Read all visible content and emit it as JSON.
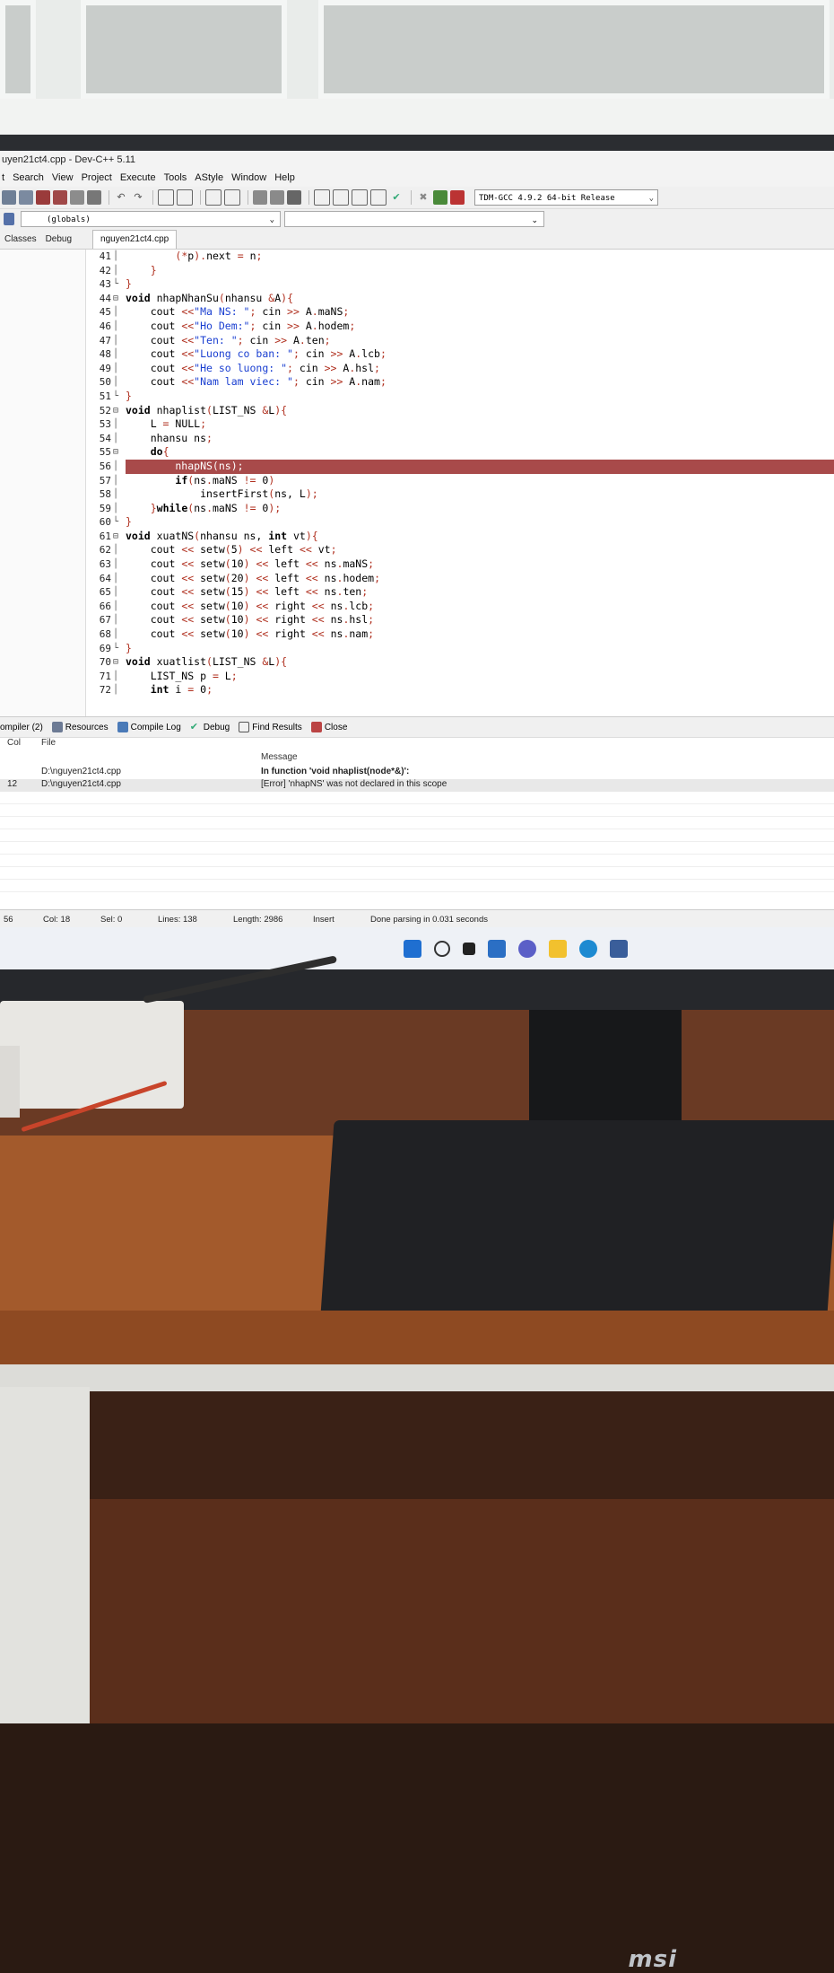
{
  "window": {
    "title": "uyen21ct4.cpp - Dev-C++ 5.11"
  },
  "menu": [
    "t",
    "Search",
    "View",
    "Project",
    "Execute",
    "Tools",
    "AStyle",
    "Window",
    "Help"
  ],
  "toolbar": {
    "compiler": "TDM-GCC 4.9.2 64-bit Release"
  },
  "scope": {
    "value": "(globals)"
  },
  "side_tabs": [
    "Classes",
    "Debug"
  ],
  "file_tab": "nguyen21ct4.cpp",
  "editor": {
    "lines": [
      {
        "n": "41",
        "code": "        (*p).next = n;"
      },
      {
        "n": "42",
        "code": "    }"
      },
      {
        "n": "43",
        "code": "}"
      },
      {
        "n": "44",
        "code": "void nhapNhanSu(nhansu &A){"
      },
      {
        "n": "45",
        "code": "    cout <<\"Ma NS: \"; cin >> A.maNS;"
      },
      {
        "n": "46",
        "code": "    cout <<\"Ho Dem:\"; cin >> A.hodem;"
      },
      {
        "n": "47",
        "code": "    cout <<\"Ten: \"; cin >> A.ten;"
      },
      {
        "n": "48",
        "code": "    cout <<\"Luong co ban: \"; cin >> A.lcb;"
      },
      {
        "n": "49",
        "code": "    cout <<\"He so luong: \"; cin >> A.hsl;"
      },
      {
        "n": "50",
        "code": "    cout <<\"Nam lam viec: \"; cin >> A.nam;"
      },
      {
        "n": "51",
        "code": "}"
      },
      {
        "n": "52",
        "code": "void nhaplist(LIST_NS &L){"
      },
      {
        "n": "53",
        "code": "    L = NULL;"
      },
      {
        "n": "54",
        "code": "    nhansu ns;"
      },
      {
        "n": "55",
        "code": "    do{"
      },
      {
        "n": "56",
        "code": "        nhapNS(ns);"
      },
      {
        "n": "57",
        "code": "        if(ns.maNS != 0)"
      },
      {
        "n": "58",
        "code": "            insertFirst(ns, L);"
      },
      {
        "n": "59",
        "code": "    }while(ns.maNS != 0);"
      },
      {
        "n": "60",
        "code": "}"
      },
      {
        "n": "61",
        "code": "void xuatNS(nhansu ns, int vt){"
      },
      {
        "n": "62",
        "code": "    cout << setw(5) << left << vt;"
      },
      {
        "n": "63",
        "code": "    cout << setw(10) << left << ns.maNS;"
      },
      {
        "n": "64",
        "code": "    cout << setw(20) << left << ns.hodem;"
      },
      {
        "n": "65",
        "code": "    cout << setw(15) << left << ns.ten;"
      },
      {
        "n": "66",
        "code": "    cout << setw(10) << right << ns.lcb;"
      },
      {
        "n": "67",
        "code": "    cout << setw(10) << right << ns.hsl;"
      },
      {
        "n": "68",
        "code": "    cout << setw(10) << right << ns.nam;"
      },
      {
        "n": "69",
        "code": "}"
      },
      {
        "n": "70",
        "code": "void xuatlist(LIST_NS &L){"
      },
      {
        "n": "71",
        "code": "    LIST_NS p = L;"
      },
      {
        "n": "72",
        "code": "    int i = 0;"
      }
    ],
    "error_line_index": 15
  },
  "bottom_tabs": [
    {
      "label": "ompiler (2)"
    },
    {
      "label": "Resources"
    },
    {
      "label": "Compile Log"
    },
    {
      "label": "Debug"
    },
    {
      "label": "Find Results"
    },
    {
      "label": "Close"
    }
  ],
  "messages": {
    "headers": {
      "col": "Col",
      "file": "File",
      "message": "Message"
    },
    "rows": [
      {
        "col": "",
        "file": "D:\\nguyen21ct4.cpp",
        "message": "In function 'void nhaplist(node*&)':"
      },
      {
        "col": "12",
        "file": "D:\\nguyen21ct4.cpp",
        "message": "[Error] 'nhapNS' was not declared in this scope"
      }
    ]
  },
  "status": {
    "line": "56",
    "col": "Col:  18",
    "sel": "Sel:  0",
    "lines": "Lines:  138",
    "length": "Length:  2986",
    "mode": "Insert",
    "parse": "Done parsing in 0.031 seconds"
  },
  "monitor_brand": "msi",
  "colors": {
    "error_line": "#a84a4a",
    "string": "#1a3fd1",
    "taskbar_bg": "#eef1f6"
  }
}
